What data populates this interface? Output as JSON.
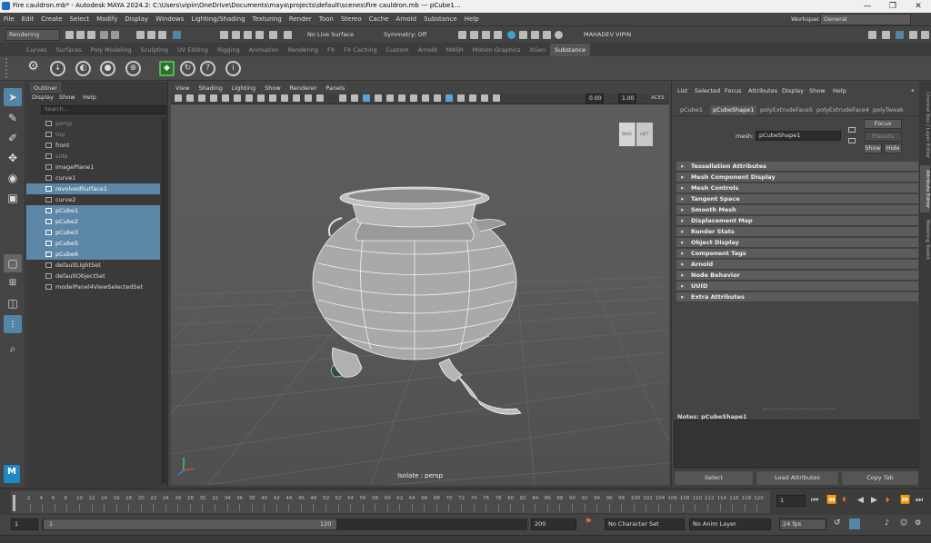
{
  "window": {
    "title": "Fire cauldron.mb* - Autodesk MAYA 2024.2: C:\\Users\\vipin\\OneDrive\\Documents\\maya\\projects\\default\\scenes\\Fire cauldron.mb  ---  pCube1...",
    "minimize": "—",
    "maximize": "❐",
    "close": "✕"
  },
  "menubar": {
    "items": [
      "File",
      "Edit",
      "Create",
      "Select",
      "Modify",
      "Display",
      "Windows",
      "Lighting/Shading",
      "Texturing",
      "Render",
      "Toon",
      "Stereo",
      "Cache",
      "Arnold",
      "Substance",
      "Help"
    ],
    "workspace_label": "Workspace:",
    "workspace_value": "General"
  },
  "statusline": {
    "menuset": "Rendering",
    "live_surface": "No Live Surface",
    "symmetry": "Symmetry: Off",
    "user": "MAHADEV VIPIN"
  },
  "shelf": {
    "tabs": [
      "Curves",
      "Surfaces",
      "Poly Modeling",
      "Sculpting",
      "UV Editing",
      "Rigging",
      "Animation",
      "Rendering",
      "FX",
      "FX Caching",
      "Custom",
      "Arnold",
      "MASH",
      "Motion Graphics",
      "XGen",
      "Substance"
    ],
    "active_tab": "Substance"
  },
  "outliner": {
    "tab": "Outliner",
    "menus": [
      "Display",
      "Show",
      "Help"
    ],
    "search_placeholder": "Search...",
    "rows": [
      {
        "label": "persp",
        "state": "dim"
      },
      {
        "label": "top",
        "state": "dim"
      },
      {
        "label": "front",
        "state": "normal"
      },
      {
        "label": "side",
        "state": "dim"
      },
      {
        "label": "imagePlane1",
        "state": "normal"
      },
      {
        "label": "curve1",
        "state": "normal"
      },
      {
        "label": "revolvedSurface1",
        "state": "sel"
      },
      {
        "label": "curve2",
        "state": "normal"
      },
      {
        "label": "pCube1",
        "state": "sel"
      },
      {
        "label": "pCube2",
        "state": "sel"
      },
      {
        "label": "pCube3",
        "state": "sel"
      },
      {
        "label": "pCube5",
        "state": "sel"
      },
      {
        "label": "pCube6",
        "state": "sel"
      },
      {
        "label": "defaultLightSet",
        "state": "normal"
      },
      {
        "label": "defaultObjectSet",
        "state": "normal"
      },
      {
        "label": "modelPanel4ViewSelectedSet",
        "state": "normal"
      }
    ]
  },
  "viewport": {
    "menus": [
      "View",
      "Shading",
      "Lighting",
      "Show",
      "Renderer",
      "Panels"
    ],
    "exposure": "0.00",
    "gamma": "1.00",
    "colorspace": "ACES",
    "isolate_label": "Isolate : persp",
    "viewcube_back": "BACK",
    "viewcube_left": "LEFT"
  },
  "attribute_editor": {
    "menus": [
      "List",
      "Selected",
      "Focus",
      "Attributes",
      "Display",
      "Show",
      "Help"
    ],
    "tabs": [
      "pCube1",
      "pCubeShape1",
      "polyExtrudeFace5",
      "polyExtrudeFace4",
      "polyTweak"
    ],
    "active_tab": "pCubeShape1",
    "mesh_label": "mesh:",
    "mesh_value": "pCubeShape1",
    "focus_btn": "Focus",
    "presets_btn": "Presets",
    "show_btn": "Show",
    "hide_btn": "Hide",
    "sections": [
      "Tessellation Attributes",
      "Mesh Component Display",
      "Mesh Controls",
      "Tangent Space",
      "Smooth Mesh",
      "Displacement Map",
      "Render Stats",
      "Object Display",
      "Component Tags",
      "Arnold",
      "Node Behavior",
      "UUID",
      "Extra Attributes"
    ],
    "notes_label": "Notes: pCubeShape1",
    "bottom_buttons": [
      "Select",
      "Load Attributes",
      "Copy Tab"
    ]
  },
  "side_tabs": [
    "Channel Box / Layer Editor",
    "Attribute Editor",
    "Modeling Toolkit"
  ],
  "timeslider": {
    "ticks": [
      2,
      4,
      6,
      8,
      10,
      12,
      14,
      16,
      18,
      20,
      22,
      24,
      26,
      28,
      30,
      32,
      34,
      36,
      38,
      40,
      42,
      44,
      46,
      48,
      50,
      52,
      54,
      56,
      58,
      60,
      62,
      64,
      66,
      68,
      70,
      72,
      74,
      76,
      78,
      80,
      82,
      84,
      86,
      88,
      90,
      92,
      94,
      96,
      98,
      100,
      102,
      104,
      106,
      108,
      110,
      112,
      114,
      116,
      118,
      120
    ],
    "current_frame": "1"
  },
  "range": {
    "start": "1",
    "inner_start": "1",
    "inner_end": "120",
    "end": "200",
    "character_set": "No Character Set",
    "anim_layer": "No Anim Layer",
    "fps": "24 fps"
  },
  "colors": {
    "selection": "#5c87a7",
    "accent_blue": "#5285a6",
    "maya_logo": "#1e88c7"
  }
}
